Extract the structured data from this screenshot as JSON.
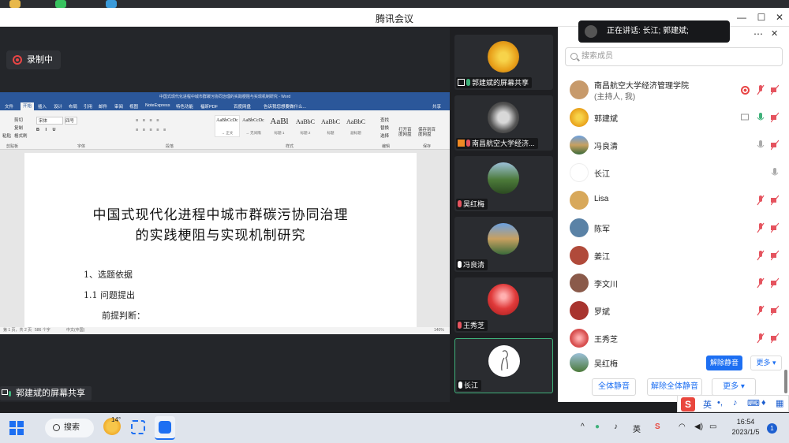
{
  "window": {
    "title": "腾讯会议"
  },
  "recording": {
    "label": "录制中"
  },
  "speaking": {
    "text": "正在讲话: 长江; 郭建斌;"
  },
  "share": {
    "label": "郭建斌的屏幕共享"
  },
  "word": {
    "window_title": "中国式现代化进程中城市群碳污协同治理的实践梗阻与实现机制研究 - Word",
    "tabs": [
      "文件",
      "开始",
      "插入",
      "设计",
      "布局",
      "引用",
      "邮件",
      "审阅",
      "视图",
      "NoteExpress",
      "特色功能",
      "福昕PDF",
      "百度网盘",
      "告诉我您想要做什么...",
      "共享"
    ],
    "ribbon": {
      "paste": "粘贴",
      "cut": "剪切",
      "copy": "复制",
      "format_painter": "格式刷",
      "font_name": "宋体",
      "font_size": "四号",
      "groups": [
        "剪贴板",
        "字体",
        "段落",
        "样式",
        "编辑",
        "保存"
      ],
      "styles": [
        {
          "preview": "AaBbCcDc",
          "name": "→ 正文"
        },
        {
          "preview": "AaBbCcDc",
          "name": "→ 无间隔"
        },
        {
          "preview": "AaBl",
          "name": "标题 1"
        },
        {
          "preview": "AaBbC",
          "name": "标题 2"
        },
        {
          "preview": "AaBbC",
          "name": "标题"
        },
        {
          "preview": "AaBbC",
          "name": "副标题"
        }
      ],
      "find": "查找",
      "replace": "替换",
      "select": "选择",
      "open_baidu": "打开百度网盘",
      "save_baidu": "保存到百度网盘"
    },
    "doc": {
      "title_line1": "中国式现代化进程中城市群碳污协同治理",
      "title_line2": "的实践梗阻与实现机制研究",
      "bullet": "",
      "section1": "1、选题依据",
      "section11": "1.1 问题提出",
      "premise": "前提判断："
    },
    "status": {
      "page": "第 1 页，共 2 页",
      "words": "586 个字",
      "lang": "中文(中国)",
      "zoom": "140%"
    }
  },
  "tiles": [
    {
      "name": "郭建斌的屏幕共享"
    },
    {
      "name": "南昌航空大学经济..."
    },
    {
      "name": "吴红梅"
    },
    {
      "name": "冯良清"
    },
    {
      "name": "王秀芝"
    },
    {
      "name": "长江"
    }
  ],
  "panel": {
    "search_placeholder": "搜索成员",
    "members": [
      {
        "name": "南昌航空大学经济管理学院",
        "sub": "(主持人, 我)",
        "mic": "muted",
        "color": "#c79a6b"
      },
      {
        "name": "郭建斌",
        "mic": "on",
        "color": "#f0b41c"
      },
      {
        "name": "冯良清",
        "mic": "off",
        "color": "#7aa4c9"
      },
      {
        "name": "长江",
        "mic": "off",
        "color": "#ffffff"
      },
      {
        "name": "Lisa",
        "mic": "muted",
        "color": "#d8a85a"
      },
      {
        "name": "陈军",
        "mic": "muted",
        "color": "#5a82a6"
      },
      {
        "name": "姜江",
        "mic": "muted",
        "color": "#b04a3a"
      },
      {
        "name": "李文川",
        "mic": "muted",
        "color": "#8a5a4a"
      },
      {
        "name": "罗斌",
        "mic": "muted",
        "color": "#a8342e"
      },
      {
        "name": "王秀芝",
        "mic": "muted",
        "color": "#d85050"
      },
      {
        "name": "吴红梅",
        "mic": "muted",
        "color": "#6a7a4a"
      }
    ],
    "unmute_label": "解除静音",
    "more_label": "更多 ▾",
    "mute_all": "全体静音",
    "unmute_all": "解除全体静音",
    "footer_more": "更多 ▾"
  },
  "ime": {
    "lang": "英"
  },
  "taskbar": {
    "search": "搜索",
    "weather": "14°",
    "ime": "英",
    "time": "16:54",
    "date": "2023/1/5",
    "notifications": "1"
  },
  "colors": {
    "accent": "#1d6ff2",
    "recording": "#e84545",
    "speaking_on": "#3fb17a",
    "muted": "#e5545f"
  }
}
